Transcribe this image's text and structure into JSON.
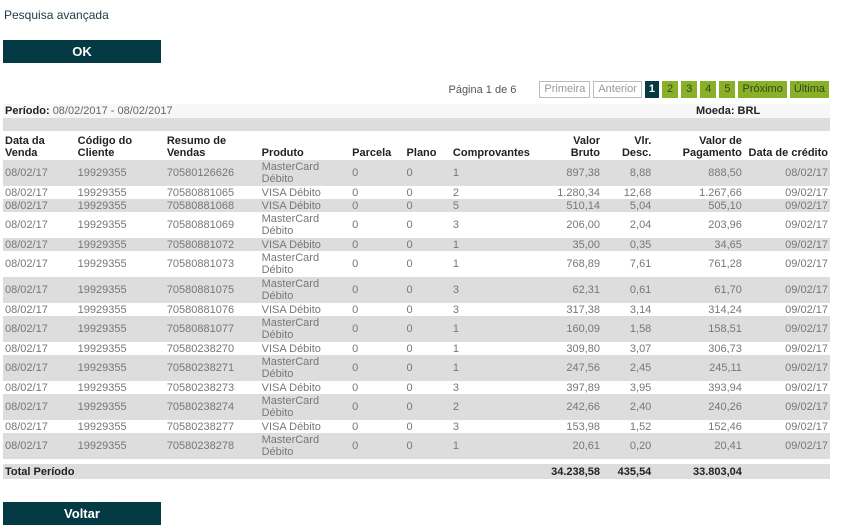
{
  "header": {
    "title": "Pesquisa avançada",
    "ok_label": "OK"
  },
  "pagination": {
    "info": "Página 1 de 6",
    "first": "Primeira",
    "previous": "Anterior",
    "pages": [
      "1",
      "2",
      "3",
      "4",
      "5"
    ],
    "current_page": "1",
    "next": "Próximo",
    "last": "Última"
  },
  "period": {
    "label": "Período",
    "value": "08/02/2017 - 08/02/2017"
  },
  "currency": "Moeda: BRL",
  "columns": [
    "Data da Venda",
    "Código do Cliente",
    "Resumo de Vendas",
    "Produto",
    "Parcela",
    "Plano",
    "Comprovantes",
    "Valor Bruto",
    "Vlr. Desc.",
    "Valor de Pagamento",
    "Data de crédito"
  ],
  "rows": [
    {
      "data_venda": "08/02/17",
      "cliente": "19929355",
      "resumo": "70580126626",
      "produto": "MasterCard Débito",
      "parcela": "0",
      "plano": "0",
      "comprovantes": "1",
      "bruto": "897,38",
      "desc": "8,88",
      "pagamento": "888,50",
      "credito": "08/02/17"
    },
    {
      "data_venda": "08/02/17",
      "cliente": "19929355",
      "resumo": "70580881065",
      "produto": "VISA Débito",
      "parcela": "0",
      "plano": "0",
      "comprovantes": "2",
      "bruto": "1.280,34",
      "desc": "12,68",
      "pagamento": "1.267,66",
      "credito": "09/02/17"
    },
    {
      "data_venda": "08/02/17",
      "cliente": "19929355",
      "resumo": "70580881068",
      "produto": "VISA Débito",
      "parcela": "0",
      "plano": "0",
      "comprovantes": "5",
      "bruto": "510,14",
      "desc": "5,04",
      "pagamento": "505,10",
      "credito": "09/02/17"
    },
    {
      "data_venda": "08/02/17",
      "cliente": "19929355",
      "resumo": "70580881069",
      "produto": "MasterCard Débito",
      "parcela": "0",
      "plano": "0",
      "comprovantes": "3",
      "bruto": "206,00",
      "desc": "2,04",
      "pagamento": "203,96",
      "credito": "09/02/17"
    },
    {
      "data_venda": "08/02/17",
      "cliente": "19929355",
      "resumo": "70580881072",
      "produto": "VISA Débito",
      "parcela": "0",
      "plano": "0",
      "comprovantes": "1",
      "bruto": "35,00",
      "desc": "0,35",
      "pagamento": "34,65",
      "credito": "09/02/17"
    },
    {
      "data_venda": "08/02/17",
      "cliente": "19929355",
      "resumo": "70580881073",
      "produto": "MasterCard Débito",
      "parcela": "0",
      "plano": "0",
      "comprovantes": "1",
      "bruto": "768,89",
      "desc": "7,61",
      "pagamento": "761,28",
      "credito": "09/02/17"
    },
    {
      "data_venda": "08/02/17",
      "cliente": "19929355",
      "resumo": "70580881075",
      "produto": "MasterCard Débito",
      "parcela": "0",
      "plano": "0",
      "comprovantes": "3",
      "bruto": "62,31",
      "desc": "0,61",
      "pagamento": "61,70",
      "credito": "09/02/17"
    },
    {
      "data_venda": "08/02/17",
      "cliente": "19929355",
      "resumo": "70580881076",
      "produto": "VISA Débito",
      "parcela": "0",
      "plano": "0",
      "comprovantes": "3",
      "bruto": "317,38",
      "desc": "3,14",
      "pagamento": "314,24",
      "credito": "09/02/17"
    },
    {
      "data_venda": "08/02/17",
      "cliente": "19929355",
      "resumo": "70580881077",
      "produto": "MasterCard Débito",
      "parcela": "0",
      "plano": "0",
      "comprovantes": "1",
      "bruto": "160,09",
      "desc": "1,58",
      "pagamento": "158,51",
      "credito": "09/02/17"
    },
    {
      "data_venda": "08/02/17",
      "cliente": "19929355",
      "resumo": "70580238270",
      "produto": "VISA Débito",
      "parcela": "0",
      "plano": "0",
      "comprovantes": "1",
      "bruto": "309,80",
      "desc": "3,07",
      "pagamento": "306,73",
      "credito": "09/02/17"
    },
    {
      "data_venda": "08/02/17",
      "cliente": "19929355",
      "resumo": "70580238271",
      "produto": "MasterCard Débito",
      "parcela": "0",
      "plano": "0",
      "comprovantes": "1",
      "bruto": "247,56",
      "desc": "2,45",
      "pagamento": "245,11",
      "credito": "09/02/17"
    },
    {
      "data_venda": "08/02/17",
      "cliente": "19929355",
      "resumo": "70580238273",
      "produto": "VISA Débito",
      "parcela": "0",
      "plano": "0",
      "comprovantes": "3",
      "bruto": "397,89",
      "desc": "3,95",
      "pagamento": "393,94",
      "credito": "09/02/17"
    },
    {
      "data_venda": "08/02/17",
      "cliente": "19929355",
      "resumo": "70580238274",
      "produto": "MasterCard Débito",
      "parcela": "0",
      "plano": "0",
      "comprovantes": "2",
      "bruto": "242,66",
      "desc": "2,40",
      "pagamento": "240,26",
      "credito": "09/02/17"
    },
    {
      "data_venda": "08/02/17",
      "cliente": "19929355",
      "resumo": "70580238277",
      "produto": "VISA Débito",
      "parcela": "0",
      "plano": "0",
      "comprovantes": "3",
      "bruto": "153,98",
      "desc": "1,52",
      "pagamento": "152,46",
      "credito": "09/02/17"
    },
    {
      "data_venda": "08/02/17",
      "cliente": "19929355",
      "resumo": "70580238278",
      "produto": "MasterCard Débito",
      "parcela": "0",
      "plano": "0",
      "comprovantes": "1",
      "bruto": "20,61",
      "desc": "0,20",
      "pagamento": "20,41",
      "credito": "09/02/17"
    }
  ],
  "total": {
    "label": "Total Período",
    "bruto": "34.238,58",
    "desc": "435,54",
    "pagamento": "33.803,04"
  },
  "footer": {
    "back_label": "Voltar"
  },
  "colors": {
    "primary": "#043a44",
    "accent": "#8ab02a",
    "row_gray": "#dddddd"
  }
}
